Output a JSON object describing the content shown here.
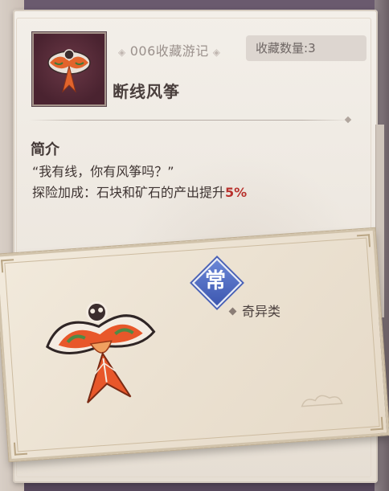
{
  "header": {
    "collection_number": "006收藏游记",
    "count_label": "收藏数量:",
    "count_value": "3"
  },
  "item": {
    "name": "断线风筝",
    "intro_title": "简介",
    "quote": "“我有线，你有风筝吗？”",
    "bonus_prefix": "探险加成：石块和矿石的产出提升",
    "bonus_value": "5%"
  },
  "card": {
    "rarity_glyph": "常",
    "category": "奇异类"
  },
  "icons": {
    "thumbnail": "kite-thumbnail-icon",
    "rarity": "rarity-common-icon",
    "category_bullet": "diamond-bullet-icon",
    "kite_illustration": "fish-kite-illustration"
  },
  "colors": {
    "bonus_highlight": "#b8322e",
    "rarity_blue": "#4b63b8"
  }
}
